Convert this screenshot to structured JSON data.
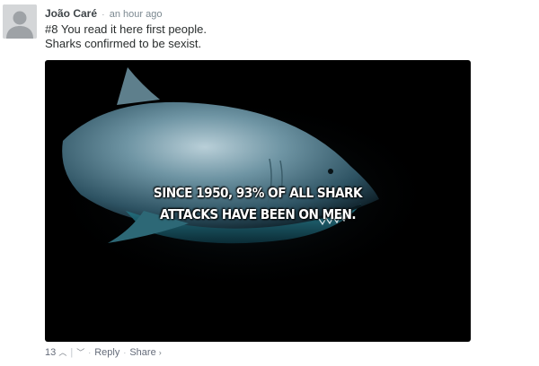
{
  "comment": {
    "author": "João Caré",
    "separator": "·",
    "timestamp": "an hour ago",
    "lines": [
      "#8 You read it here first people.",
      "Sharks confirmed to be sexist."
    ]
  },
  "media": {
    "caption_lines": [
      "SINCE 1950, 93% OF ALL SHARK",
      "ATTACKS HAVE BEEN ON MEN."
    ]
  },
  "footer": {
    "upvote_count": "13",
    "upvote_icon": "chevron-up-icon",
    "divider": "|",
    "downvote_icon": "chevron-down-icon",
    "dot": "·",
    "reply_label": "Reply",
    "share_label": "Share",
    "share_icon": "chevron-right-icon"
  },
  "colors": {
    "author": "#3f4549",
    "meta": "#7b8890",
    "body_text": "#2a2e2e",
    "footer_text": "#656c7a",
    "media_background": "#000000"
  }
}
